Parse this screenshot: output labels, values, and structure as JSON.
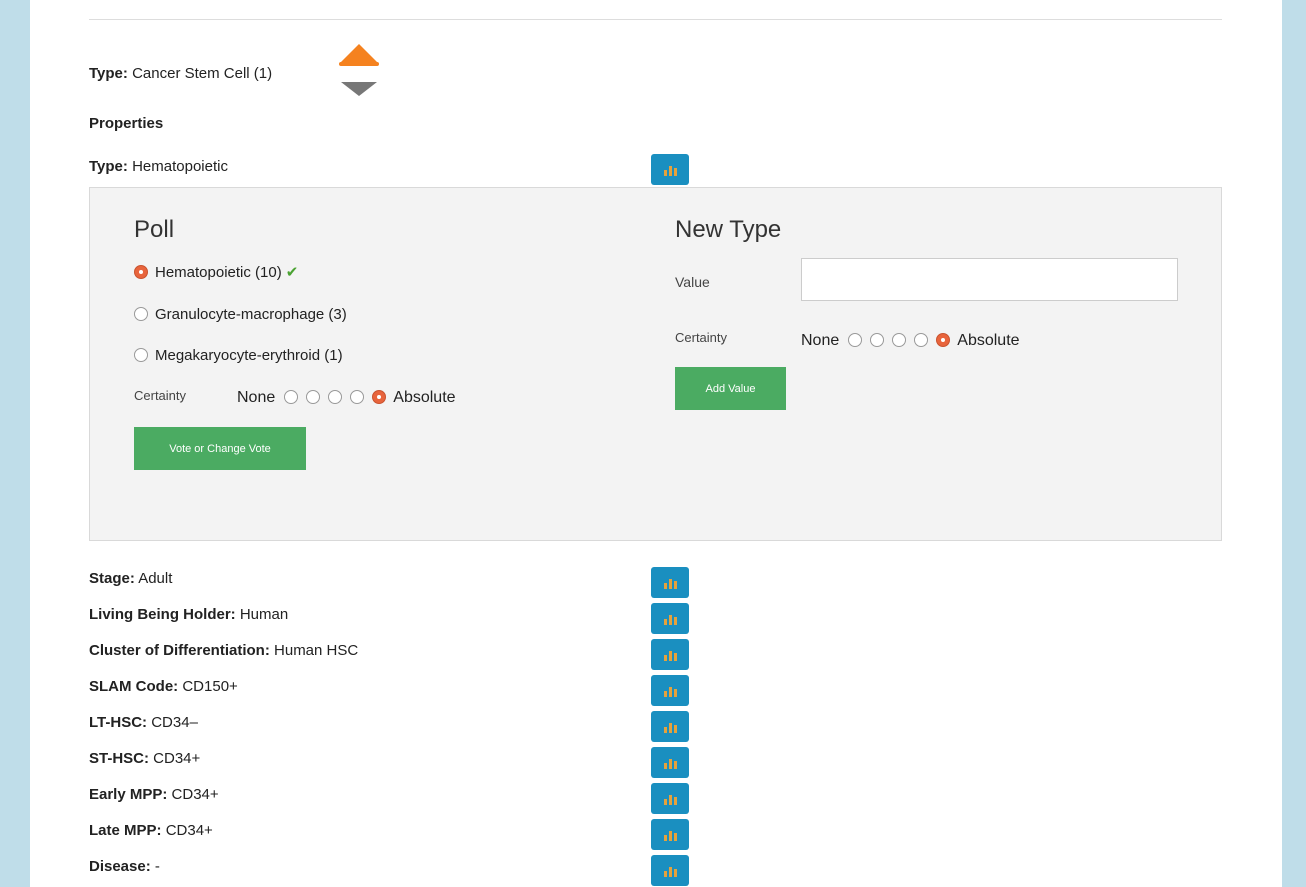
{
  "header": {
    "type_label": "Type:",
    "type_value": "Cancer Stem Cell (1)",
    "properties_heading": "Properties"
  },
  "vote_arrows": {
    "up": "upvote-arrow",
    "down": "downvote-arrow"
  },
  "type_property": {
    "label": "Type:",
    "value": "Hematopoietic"
  },
  "poll": {
    "title": "Poll",
    "options": [
      {
        "label": "Hematopoietic (10)",
        "selected": true,
        "verified": true
      },
      {
        "label": "Granulocyte-macrophage (3)",
        "selected": false,
        "verified": false
      },
      {
        "label": "Megakaryocyte-erythroid (1)",
        "selected": false,
        "verified": false
      }
    ],
    "certainty_label": "Certainty",
    "certainty_min": "None",
    "certainty_max": "Absolute",
    "certainty_level": 5,
    "vote_button": "Vote or Change Vote"
  },
  "new_type": {
    "title": "New Type",
    "value_label": "Value",
    "value_input": "",
    "certainty_label": "Certainty",
    "certainty_min": "None",
    "certainty_max": "Absolute",
    "certainty_level": 5,
    "add_button": "Add Value"
  },
  "properties": [
    {
      "label": "Stage:",
      "value": "Adult"
    },
    {
      "label": "Living Being Holder:",
      "value": "Human"
    },
    {
      "label": "Cluster of Differentiation:",
      "value": "Human HSC"
    },
    {
      "label": "SLAM Code:",
      "value": "CD150+"
    },
    {
      "label": "LT-HSC:",
      "value": "CD34–"
    },
    {
      "label": "ST-HSC:",
      "value": "CD34+"
    },
    {
      "label": "Early MPP:",
      "value": "CD34+"
    },
    {
      "label": "Late MPP:",
      "value": "CD34+"
    },
    {
      "label": "Disease:",
      "value": "-"
    }
  ],
  "colors": {
    "background": "#bfdde9",
    "stats_button": "#1a8fc0",
    "upvote": "#f5821f",
    "downvote": "#777777",
    "green_button": "#4bab62",
    "radio_selected": "#e8643c",
    "check": "#4aa232"
  }
}
